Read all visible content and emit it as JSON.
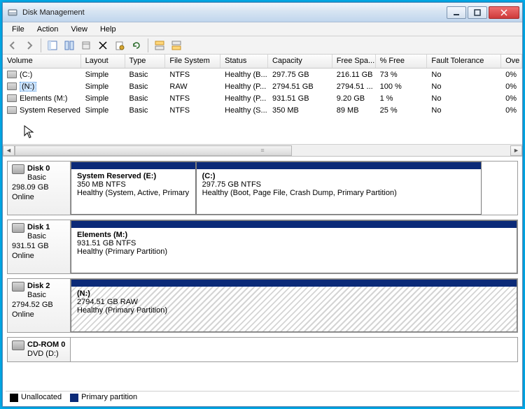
{
  "title": "Disk Management",
  "menu": {
    "file": "File",
    "action": "Action",
    "view": "View",
    "help": "Help"
  },
  "columns": [
    "Volume",
    "Layout",
    "Type",
    "File System",
    "Status",
    "Capacity",
    "Free Spa...",
    "% Free",
    "Fault Tolerance",
    "Ove"
  ],
  "volumes": [
    {
      "name": "(C:)",
      "layout": "Simple",
      "type": "Basic",
      "fs": "NTFS",
      "status": "Healthy (B...",
      "capacity": "297.75 GB",
      "free": "216.11 GB",
      "pfree": "73 %",
      "fault": "No",
      "ovh": "0%",
      "selected": false
    },
    {
      "name": "(N:)",
      "layout": "Simple",
      "type": "Basic",
      "fs": "RAW",
      "status": "Healthy (P...",
      "capacity": "2794.51 GB",
      "free": "2794.51 ...",
      "pfree": "100 %",
      "fault": "No",
      "ovh": "0%",
      "selected": true
    },
    {
      "name": "Elements (M:)",
      "layout": "Simple",
      "type": "Basic",
      "fs": "NTFS",
      "status": "Healthy (P...",
      "capacity": "931.51 GB",
      "free": "9.20 GB",
      "pfree": "1 %",
      "fault": "No",
      "ovh": "0%",
      "selected": false
    },
    {
      "name": "System Reserved (...",
      "layout": "Simple",
      "type": "Basic",
      "fs": "NTFS",
      "status": "Healthy (S...",
      "capacity": "350 MB",
      "free": "89 MB",
      "pfree": "25 %",
      "fault": "No",
      "ovh": "0%",
      "selected": false
    }
  ],
  "disks": [
    {
      "label": "Disk 0",
      "type": "Basic",
      "size": "298.09 GB",
      "state": "Online",
      "parts": [
        {
          "title": "System Reserved  (E:)",
          "line2": "350 MB NTFS",
          "line3": "Healthy (System, Active, Primary",
          "widthpct": 28,
          "hatched": false
        },
        {
          "title": "(C:)",
          "line2": "297.75 GB NTFS",
          "line3": "Healthy (Boot, Page File, Crash Dump, Primary Partition)",
          "widthpct": 64,
          "hatched": false
        }
      ]
    },
    {
      "label": "Disk 1",
      "type": "Basic",
      "size": "931.51 GB",
      "state": "Online",
      "parts": [
        {
          "title": "Elements  (M:)",
          "line2": "931.51 GB NTFS",
          "line3": "Healthy (Primary Partition)",
          "widthpct": 100,
          "hatched": false
        }
      ]
    },
    {
      "label": "Disk 2",
      "type": "Basic",
      "size": "2794.52 GB",
      "state": "Online",
      "parts": [
        {
          "title": "(N:)",
          "line2": "2794.51 GB RAW",
          "line3": "Healthy (Primary Partition)",
          "widthpct": 100,
          "hatched": true
        }
      ]
    },
    {
      "label": "CD-ROM 0",
      "type": "DVD (D:)",
      "size": "",
      "state": "",
      "parts": []
    }
  ],
  "legend": {
    "unalloc": "Unallocated",
    "primary": "Primary partition"
  }
}
